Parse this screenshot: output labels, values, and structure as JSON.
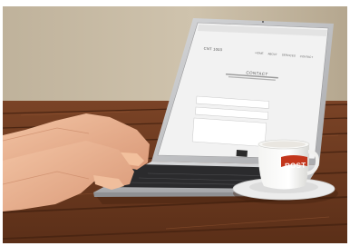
{
  "website": {
    "logo": "CNT 1003",
    "nav": [
      "HOME",
      "ABOUT",
      "SERVICES",
      "CONTACT"
    ],
    "heading": "CONTACT"
  },
  "cup": {
    "brand": "ROST"
  },
  "colors": {
    "wall": "#c9bca6",
    "table_wood": "#8a4a28",
    "laptop_silver": "#c4c5c7",
    "screen_bg": "#f2f2f2",
    "cup_label": "#c2361c"
  }
}
